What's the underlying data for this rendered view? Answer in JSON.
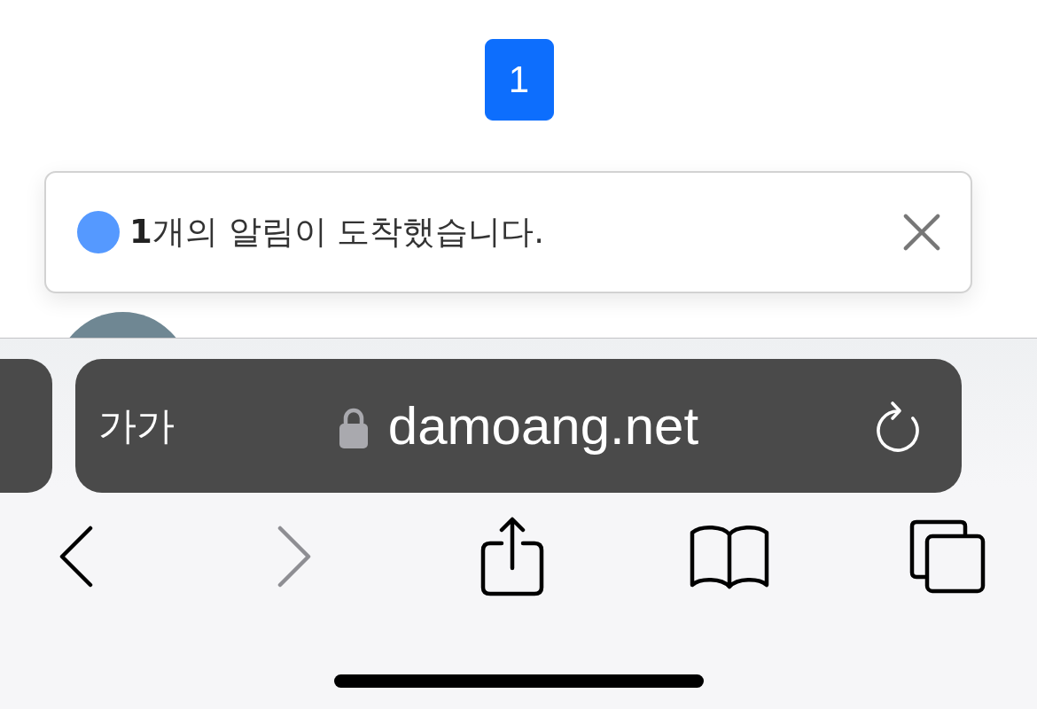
{
  "pagination": [
    {
      "label": "1",
      "selected": true
    }
  ],
  "notification": {
    "text": "**1**개의 알림이 도착했습니다."
  },
  "browser": {
    "address_bar": {
      "text_size_button": "가가",
      "secure": true,
      "url": "damoang.net"
    },
    "toolbar": [
      {
        "kind": "back",
        "disabled": false
      },
      {
        "kind": "forward",
        "disabled": true
      },
      {
        "kind": "share",
        "disabled": false
      },
      {
        "kind": "bookmarks",
        "disabled": false
      },
      {
        "kind": "tabs",
        "disabled": false
      }
    ]
  }
}
